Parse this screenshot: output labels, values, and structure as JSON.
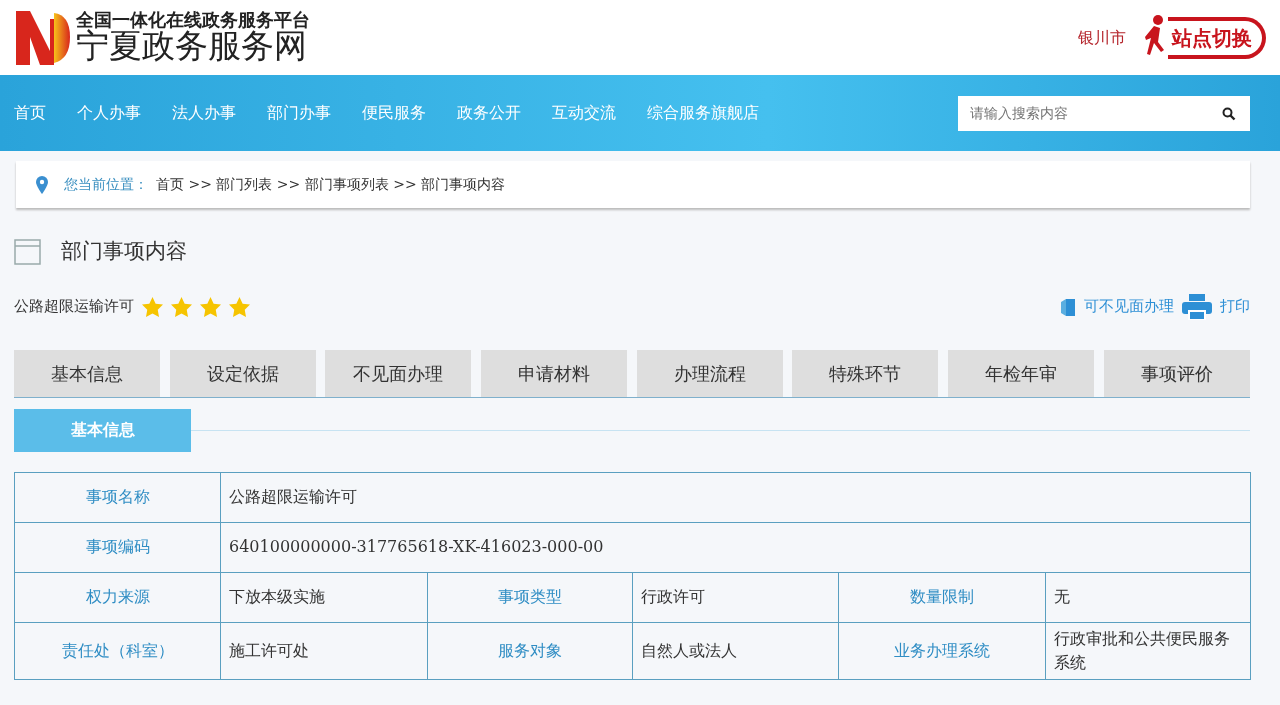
{
  "header": {
    "tagline": "全国一体化在线政务服务平台",
    "site_name": "宁夏政务服务网",
    "city": "银川市",
    "switch_label": "站点切换"
  },
  "nav": {
    "items": [
      "首页",
      "个人办事",
      "法人办事",
      "部门办事",
      "便民服务",
      "政务公开",
      "互动交流",
      "综合服务旗舰店"
    ],
    "search": {
      "placeholder": "请输入搜索内容"
    }
  },
  "breadcrumb": {
    "label": "您当前位置：",
    "path": "首页 >> 部门列表 >> 部门事项列表 >> 部门事项内容"
  },
  "section_title": "部门事项内容",
  "item": {
    "name": "公路超限运输许可",
    "stars": 4,
    "actions": [
      {
        "kind": "remote",
        "label": "可不见面办理"
      },
      {
        "kind": "print",
        "label": "打印"
      }
    ]
  },
  "tabs": [
    {
      "label": "基本信息",
      "selected": false
    },
    {
      "label": "设定依据",
      "selected": false
    },
    {
      "label": "不见面办理",
      "selected": false
    },
    {
      "label": "申请材料",
      "selected": false
    },
    {
      "label": "办理流程",
      "selected": false
    },
    {
      "label": "特殊环节",
      "selected": false
    },
    {
      "label": "年检年审",
      "selected": false
    },
    {
      "label": "事项评价",
      "selected": false
    }
  ],
  "subtab": "基本信息",
  "table": {
    "rows": [
      [
        {
          "label": "事项名称",
          "value": "公路超限运输许可"
        }
      ],
      [
        {
          "label": "事项编码",
          "value": "640100000000-317765618-XK-416023-000-00"
        }
      ],
      [
        {
          "label": "权力来源",
          "value": "下放本级实施"
        },
        {
          "label": "事项类型",
          "value": "行政许可"
        },
        {
          "label": "数量限制",
          "value": "无"
        }
      ],
      [
        {
          "label": "责任处（科室）",
          "value": "施工许可处"
        },
        {
          "label": "服务对象",
          "value": "自然人或法人"
        },
        {
          "label": "业务办理系统",
          "value": "行政审批和公共便民服务系统"
        }
      ]
    ]
  }
}
